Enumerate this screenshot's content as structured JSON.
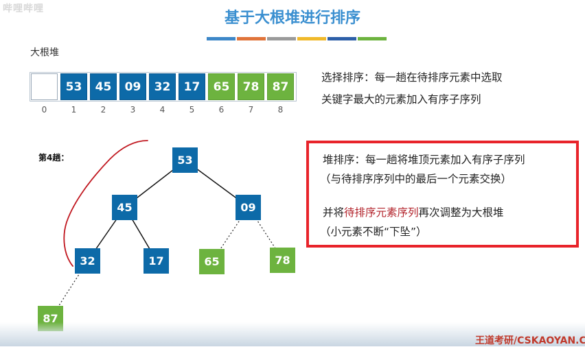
{
  "logo_text": "哔哩哔哩",
  "title": "基于大根堆进行排序",
  "accent_colors": [
    "#3d87c8",
    "#e0743a",
    "#9a9a9a",
    "#f0b92a",
    "#2d5fa8",
    "#6db33f"
  ],
  "array": {
    "label": "大根堆",
    "cells": [
      {
        "value": "",
        "color": "empty"
      },
      {
        "value": "53",
        "color": "blue"
      },
      {
        "value": "45",
        "color": "blue"
      },
      {
        "value": "09",
        "color": "blue"
      },
      {
        "value": "32",
        "color": "blue"
      },
      {
        "value": "17",
        "color": "blue"
      },
      {
        "value": "65",
        "color": "green"
      },
      {
        "value": "78",
        "color": "green"
      },
      {
        "value": "87",
        "color": "green"
      }
    ],
    "indices": [
      "0",
      "1",
      "2",
      "3",
      "4",
      "5",
      "6",
      "7",
      "8"
    ]
  },
  "selection_sort": {
    "line1": "选择排序：每一趟在待排序元素中选取",
    "line2": "关键字最大的元素加入有序子序列"
  },
  "trip_label": "第4趟：",
  "tree": {
    "n53": "53",
    "n45": "45",
    "n09": "09",
    "n32": "32",
    "n17": "17",
    "n65": "65",
    "n78": "78",
    "n87": "87"
  },
  "heap_sort": {
    "line1": "堆排序：每一趟将堆顶元素加入有序子序列",
    "line2": "（与待排序序列中的最后一个元素交换）",
    "line3_prefix": "并将",
    "line3_highlight": "待排序元素序列",
    "line3_suffix": "再次调整为大根堆",
    "line4": "（小元素不断“下坠”）"
  },
  "credit": "王道考研/CSKAOYAN.C"
}
